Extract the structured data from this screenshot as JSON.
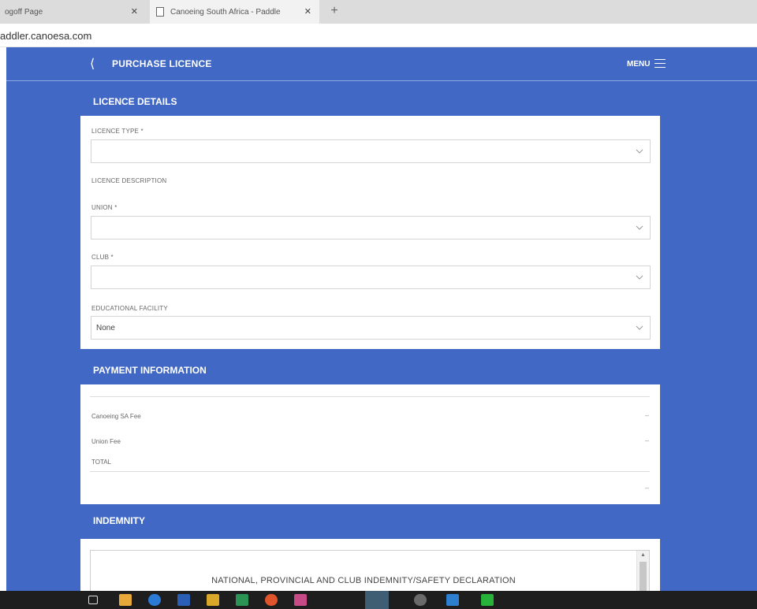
{
  "browser": {
    "tabs": [
      {
        "title": "ogoff Page",
        "active": false
      },
      {
        "title": "Canoeing South Africa - Paddle",
        "active": true
      }
    ],
    "url": "addler.canoesa.com"
  },
  "header": {
    "title": "PURCHASE LICENCE",
    "menu_label": "MENU"
  },
  "licence_details": {
    "title": "LICENCE DETAILS",
    "licence_type": {
      "label": "LICENCE TYPE *",
      "value": ""
    },
    "licence_description": {
      "label": "LICENCE DESCRIPTION"
    },
    "union": {
      "label": "UNION *",
      "value": ""
    },
    "club": {
      "label": "CLUB *",
      "value": ""
    },
    "educational_facility": {
      "label": "EDUCATIONAL FACILITY",
      "value": "None"
    }
  },
  "payment": {
    "title": "PAYMENT INFORMATION",
    "rows": [
      {
        "label": "Canoeing SA Fee",
        "value": "–"
      },
      {
        "label": "Union Fee",
        "value": "–"
      }
    ],
    "total_label": "TOTAL",
    "total_value": "–"
  },
  "indemnity": {
    "title": "INDEMNITY",
    "heading": "NATIONAL, PROVINCIAL AND CLUB INDEMNITY/SAFETY DECLARATION"
  },
  "colors": {
    "app_background": "#4068c4",
    "panel": "#ffffff",
    "taskbar": "#1e1e1e"
  },
  "taskbar_icons": [
    "task-view-icon",
    "explorer-icon",
    "edge-icon",
    "word-icon",
    "folder-icon",
    "excel-icon",
    "chrome-icon",
    "calendar-icon",
    "media-icon",
    "settings-icon",
    "photos-icon",
    "green-app-icon"
  ]
}
